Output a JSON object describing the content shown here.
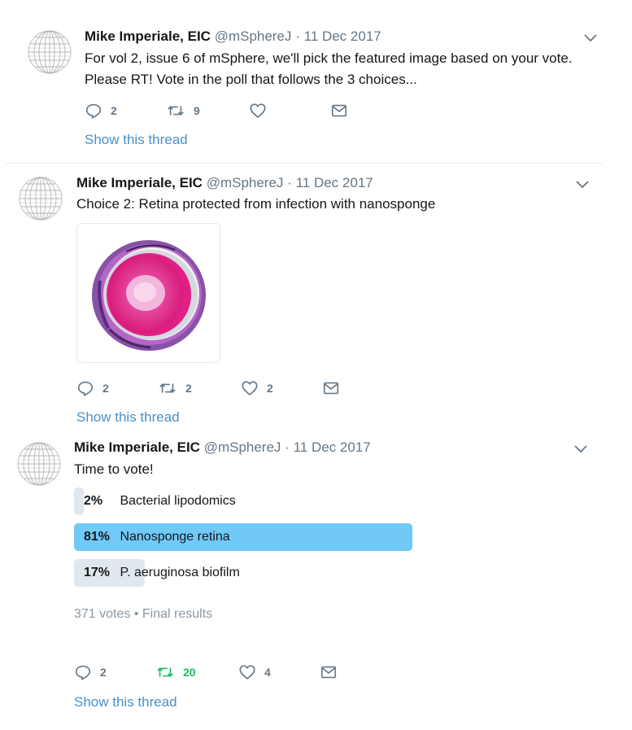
{
  "tweets": [
    {
      "author": "Mike Imperiale, EIC",
      "handle": "@mSphereJ",
      "sep": "·",
      "date": "11 Dec 2017",
      "text_line1": "For vol 2, issue 6 of mSphere, we'll pick the featured image based on your vote.",
      "text_line2": "Please RT! Vote in the poll that follows the 3 choices...",
      "replies": "2",
      "retweets": "9",
      "likes": "",
      "show_thread": "Show this thread"
    },
    {
      "author": "Mike Imperiale, EIC",
      "handle": "@mSphereJ",
      "sep": "·",
      "date": "11 Dec 2017",
      "text_line1": "Choice 2: Retina protected from infection with nanosponge",
      "replies": "2",
      "retweets": "2",
      "likes": "2",
      "show_thread": "Show this thread"
    },
    {
      "author": "Mike Imperiale, EIC",
      "handle": "@mSphereJ",
      "sep": "·",
      "date": "11 Dec 2017",
      "text_line1": "Time to vote!",
      "poll": {
        "options": [
          {
            "percent": "2%",
            "label": "Bacterial lipodomics",
            "value": 0.02,
            "winner": false
          },
          {
            "percent": "81%",
            "label": "Nanosponge retina",
            "value": 0.81,
            "winner": true
          },
          {
            "percent": "17%",
            "label": "P. aeruginosa biofilm",
            "value": 0.17,
            "winner": false
          }
        ],
        "votes": "371 votes",
        "bullet": "•",
        "status": "Final results"
      },
      "replies": "2",
      "retweets": "20",
      "likes": "4",
      "show_thread": "Show this thread"
    }
  ],
  "colors": {
    "accent_link": "#4a90c8",
    "poll_winner": "#71c9f8",
    "poll_bar": "#e1e8ed",
    "retweet_active": "#17bf63",
    "icon_gray": "#657786"
  },
  "icons": [
    "globe-avatar-icon",
    "chevron-down-icon",
    "reply-icon",
    "retweet-icon",
    "like-icon",
    "message-icon"
  ]
}
